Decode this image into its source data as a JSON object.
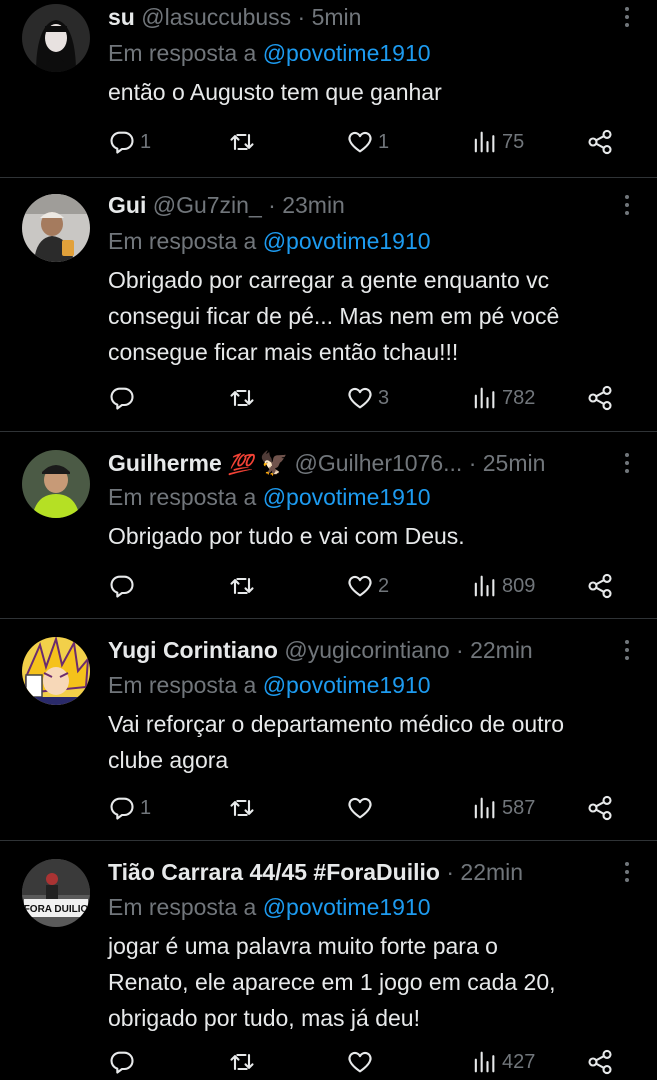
{
  "reply_prefix": "Em resposta a",
  "tweets": [
    {
      "name": "su",
      "badge": "",
      "handle": "@lasuccubuss",
      "time": "5min",
      "mention": "@povotime1910",
      "lines": [
        "então o Augusto tem que ganhar"
      ],
      "replies": "1",
      "likes": "1",
      "views": "75"
    },
    {
      "name": "Gui",
      "badge": "",
      "handle": "@Gu7zin_",
      "time": "23min",
      "mention": "@povotime1910",
      "lines": [
        "Obrigado por carregar a gente enquanto vc",
        "consegui ficar de pé... Mas nem em pé você",
        "consegue ficar mais então tchau!!!"
      ],
      "replies": "",
      "likes": "3",
      "views": "782"
    },
    {
      "name": "Guilherme",
      "badge": "💯",
      "handle": "@Guilher1076...",
      "time": "25min",
      "mention": "@povotime1910",
      "lines": [
        "Obrigado por tudo e vai com Deus."
      ],
      "replies": "",
      "likes": "2",
      "views": "809"
    },
    {
      "name": "Yugi Corintiano",
      "badge": "",
      "handle": "@yugicorintiano",
      "time": "22min",
      "mention": "@povotime1910",
      "lines": [
        "Vai reforçar o departamento médico de outro",
        "clube agora"
      ],
      "replies": "1",
      "likes": "",
      "views": "587"
    },
    {
      "name": "Tião Carrara 44/45 #ForaDuilio",
      "badge": "",
      "handle": "",
      "time": "22min",
      "mention": "@povotime1910",
      "lines": [
        "jogar é uma palavra muito forte para o",
        "Renato, ele aparece em 1 jogo em cada 20,",
        "obrigado por tudo, mas já deu!"
      ],
      "replies": "",
      "likes": "",
      "views": "427",
      "avatar_text": "FORA DUILIO"
    }
  ],
  "icons": {
    "reply": "reply-icon",
    "retweet": "retweet-icon",
    "like": "heart-icon",
    "views": "views-icon",
    "share": "share-icon",
    "more": "more-icon"
  },
  "colors": {
    "background": "#000000",
    "text": "#e7e9ea",
    "muted": "#71767b",
    "link": "#1d9bf0",
    "divider": "#2f3336"
  }
}
